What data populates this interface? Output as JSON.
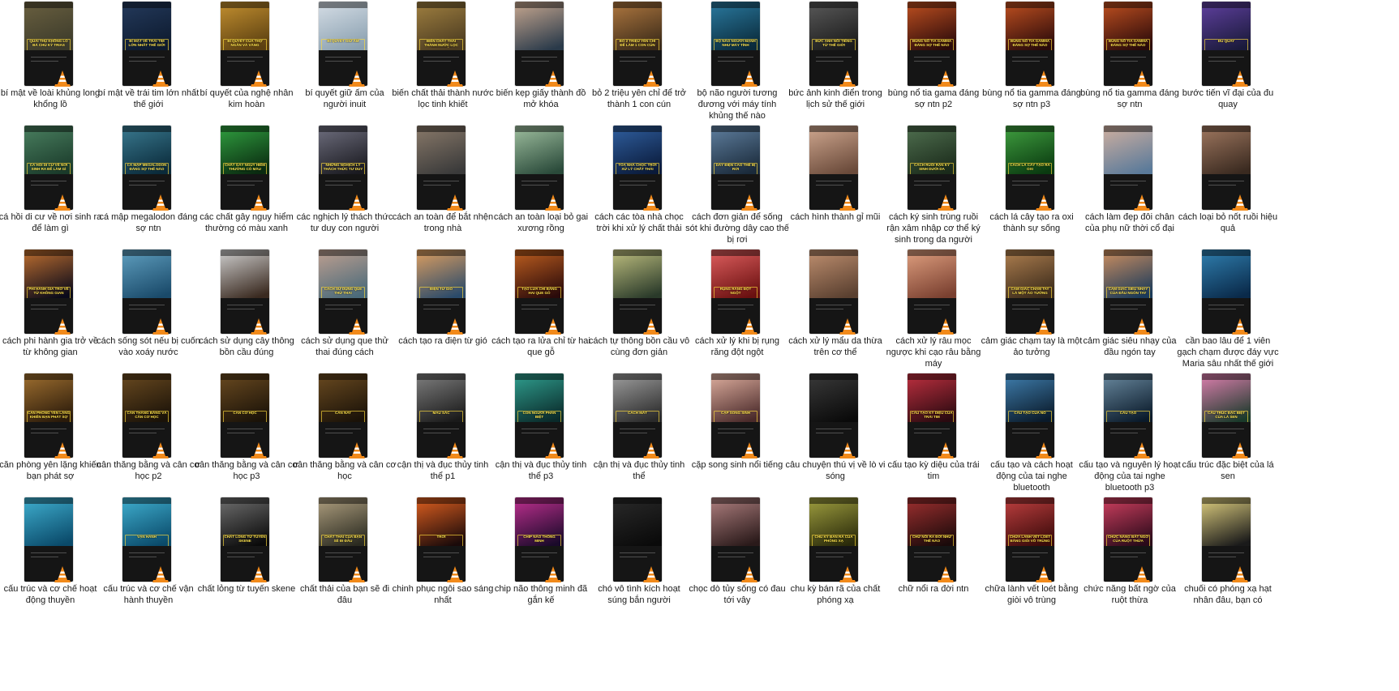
{
  "colors": {
    "background": "#ffffff",
    "label_text": "#1a1a1a",
    "caption_text": "#ffe44d",
    "vlc_orange": "#f28a1a",
    "vlc_white": "#ffffff"
  },
  "file_icon": "vlc-cone-icon",
  "files": [
    {
      "label": "bí mật về loài khủng long khổng lồ",
      "caption": "QUÁI THÚ KHỔNG LỒ BÁ CHỦ KỶ TRIAS",
      "thumb_colors": [
        "#3b3a2a",
        "#6a6040"
      ]
    },
    {
      "label": "bí mật về trái tim lớn nhất thế giới",
      "caption": "BÍ MẬT VỀ TRÁI TIM LỚN NHẤT THẾ GIỚI",
      "thumb_colors": [
        "#0d1a2e",
        "#243a5c"
      ]
    },
    {
      "label": "bí quyết của nghệ nhân kim hoàn",
      "caption": "BÍ QUYẾT CỦA THỢ NGÂN VÀ VÀNG",
      "thumb_colors": [
        "#5a3f10",
        "#c49030"
      ]
    },
    {
      "label": "bí quyết giữ ấm của người inuit",
      "caption": "BÍ QUYẾT GIỮ ẤM",
      "thumb_colors": [
        "#8aa0b0",
        "#d6dee6"
      ]
    },
    {
      "label": "biến chất thải thành nước lọc tinh khiết",
      "caption": "BIẾN CHẤT THẢI THÀNH NƯỚC LỌC TINH KHIẾT",
      "thumb_colors": [
        "#4a3a20",
        "#a08040"
      ]
    },
    {
      "label": "biến kẹp giấy thành đồ mở khóa",
      "caption": "",
      "thumb_colors": [
        "#2a3a4a",
        "#c8a890"
      ]
    },
    {
      "label": "bỏ 2 triệu yên chỉ để trở thành 1 con cún",
      "caption": "BỎ 2 TRIỆU YÊN CHỈ ĐỂ LÀM 1 CON CÚN",
      "thumb_colors": [
        "#3a2a18",
        "#b07840"
      ]
    },
    {
      "label": "bộ não người tương đương với máy tính khủng thế nào",
      "caption": "BỘ NÃO NGƯỜI MẠNH NHƯ MÁY TÍNH",
      "thumb_colors": [
        "#0a2a3a",
        "#2a7aa0"
      ]
    },
    {
      "label": "bức ảnh kinh điển trong lịch sử thế giới",
      "caption": "BỨC ẢNH NỔI TIẾNG TỪ THẾ GIỚI",
      "thumb_colors": [
        "#1a1a1a",
        "#5a5a5a"
      ]
    },
    {
      "label": "bùng nổ tia gama đáng sợ ntn p2",
      "caption": "BÙNG NỔ TIA GAMMA ĐÁNG SỢ THẾ NÀO",
      "thumb_colors": [
        "#2a0a0a",
        "#c05020"
      ]
    },
    {
      "label": "bùng nổ tia gamma đáng sợ ntn p3",
      "caption": "BÙNG NỔ TIA GAMMA ĐÁNG SỢ THẾ NÀO",
      "thumb_colors": [
        "#2a0a0a",
        "#c05020"
      ]
    },
    {
      "label": "bùng nổ tia gamma đáng sợ ntn",
      "caption": "BÙNG NỔ TIA GAMMA ĐÁNG SỢ THẾ NÀO",
      "thumb_colors": [
        "#2a0a0a",
        "#c05020"
      ]
    },
    {
      "label": "bước tiến vĩ đại của đu quay",
      "caption": "ĐU QUAY",
      "thumb_colors": [
        "#1a1a3a",
        "#6040a0"
      ]
    },
    {
      "label": "cá hồi di cư về nơi sinh ra để làm gì",
      "caption": "CÁ HỒI DI CƯ VỀ NƠI SINH RA ĐỂ LÀM GÌ",
      "thumb_colors": [
        "#1a3a2a",
        "#4a8060"
      ]
    },
    {
      "label": "cá mập megalodon đáng sợ ntn",
      "caption": "CÁ MẬP MEGALODON ĐÁNG SỢ THẾ NÀO",
      "thumb_colors": [
        "#0a2a3a",
        "#3a7a90"
      ]
    },
    {
      "label": "các chất gây nguy hiểm thường có màu xanh",
      "caption": "CHẤT GÂY NGUY HIỂM THƯỜNG CÓ MÀU XANH",
      "thumb_colors": [
        "#0a2a10",
        "#30a040"
      ]
    },
    {
      "label": "các nghịch lý thách thức tư duy con người",
      "caption": "NHỮNG NGHỊCH LÝ THÁCH THỨC TƯ DUY",
      "thumb_colors": [
        "#1a1a20",
        "#707080"
      ]
    },
    {
      "label": "cách an toàn để bắt nhện trong nhà",
      "caption": "",
      "thumb_colors": [
        "#3a3a3a",
        "#8a7a6a"
      ]
    },
    {
      "label": "cách an toàn loại bỏ gai xương rồng",
      "caption": "",
      "thumb_colors": [
        "#2a4a3a",
        "#a0c0a0"
      ]
    },
    {
      "label": "cách các tòa nhà chọc trời khi xử lý chất thải",
      "caption": "TÒA NHÀ CHỌC TRỜI XỬ LÝ CHẤT THẢI",
      "thumb_colors": [
        "#0a1a3a",
        "#3060a0"
      ]
    },
    {
      "label": "cách đơn giản để sống sót khi đường dây cao thế bị rơi",
      "caption": "DÂY ĐIỆN CAO THẾ BỊ RƠI",
      "thumb_colors": [
        "#1a2a3a",
        "#6080a0"
      ]
    },
    {
      "label": "cách hình thành gỉ mũi",
      "caption": "",
      "thumb_colors": [
        "#6a4a3a",
        "#d0a890"
      ]
    },
    {
      "label": "cách ký sinh trùng ruồi rận xâm nhập cơ thể ký sinh trong da người",
      "caption": "CÁCH RUỒI RẬN KÝ SINH DƯỚI DA",
      "thumb_colors": [
        "#1a2a1a",
        "#507050"
      ]
    },
    {
      "label": "cách lá cây tạo ra oxi thành sự sống",
      "caption": "CÁCH LÁ CÂY TẠO RA OXI",
      "thumb_colors": [
        "#0a3a10",
        "#40a040"
      ]
    },
    {
      "label": "cách làm đẹp đôi chân của phụ nữ thời cổ đại",
      "caption": "",
      "thumb_colors": [
        "#5a7a9a",
        "#d0b0a0"
      ]
    },
    {
      "label": "cách loại bỏ nốt ruồi hiệu quả",
      "caption": "",
      "thumb_colors": [
        "#3a2a20",
        "#a07860"
      ]
    },
    {
      "label": "cách phi hành gia trở về từ không gian",
      "caption": "PHI HÀNH GIA TRỞ VỀ TỪ KHÔNG GIAN",
      "thumb_colors": [
        "#0a0a1a",
        "#c07030"
      ]
    },
    {
      "label": "cách sống sót nếu bị cuốn vào xoáy nước",
      "caption": "",
      "thumb_colors": [
        "#1a4a6a",
        "#60a0c0"
      ]
    },
    {
      "label": "cách sử dụng cây thông bồn cầu đúng",
      "caption": "",
      "thumb_colors": [
        "#3a2a20",
        "#d0d0d0"
      ]
    },
    {
      "label": "cách sử dụng que thử thai đúng cách",
      "caption": "CÁCH SỬ DỤNG QUE THỬ THAI",
      "thumb_colors": [
        "#4a6a7a",
        "#c0a090"
      ]
    },
    {
      "label": "cách tạo ra điện từ gió",
      "caption": "ĐIỆN TỪ GIÓ",
      "thumb_colors": [
        "#2a4a6a",
        "#e0a060"
      ]
    },
    {
      "label": "cách tạo ra lửa chỉ từ hai que gỗ",
      "caption": "TẠO LỬA CHỈ BẰNG HAI QUE GỖ",
      "thumb_colors": [
        "#2a0a0a",
        "#c06020"
      ]
    },
    {
      "label": "cách tự thông bồn cầu vô cùng đơn giản",
      "caption": "",
      "thumb_colors": [
        "#2a3a2a",
        "#c0c080"
      ]
    },
    {
      "label": "cách xử lý khi bị rụng răng đột ngột",
      "caption": "RỤNG RĂNG ĐỘT NGỘT",
      "thumb_colors": [
        "#6a1010",
        "#e06060"
      ]
    },
    {
      "label": "cách xử lý mẩu da thừa trên cơ thể",
      "caption": "",
      "thumb_colors": [
        "#5a4030",
        "#c09070"
      ]
    },
    {
      "label": "cách xử lý râu mọc ngược khi cạo râu bằng máy",
      "caption": "",
      "thumb_colors": [
        "#7a4030",
        "#e0a080"
      ]
    },
    {
      "label": "cảm giác chạm tay là một ảo tưởng",
      "caption": "CẢM GIÁC CHẠM TAY LÀ MỘT ẢO TƯỞNG",
      "thumb_colors": [
        "#3a2a1a",
        "#b08050"
      ]
    },
    {
      "label": "cảm giác siêu nhạy của đầu ngón tay",
      "caption": "CẢM GIÁC SIÊU NHẠY CỦA ĐẦU NGÓN TAY",
      "thumb_colors": [
        "#1a3a5a",
        "#d09060"
      ]
    },
    {
      "label": "cần bao lâu để 1 viên gạch chạm được đáy vực Maria sâu nhất thế giới",
      "caption": "",
      "thumb_colors": [
        "#0a2a4a",
        "#3080b0"
      ]
    },
    {
      "label": "căn phòng yên lặng khiến bạn phát sợ",
      "caption": "CĂN PHÒNG YÊN LẶNG KHIẾN BẠN PHÁT SỢ",
      "thumb_colors": [
        "#2a1a0a",
        "#a07030"
      ]
    },
    {
      "label": "cân thăng bằng và cân cơ học p2",
      "caption": "CÂN THĂNG BẰNG VÀ CÂN CƠ HỌC",
      "thumb_colors": [
        "#1a1208",
        "#6a4a20"
      ]
    },
    {
      "label": "cân thăng bằng và cân cơ học p3",
      "caption": "CÂN CƠ HỌC",
      "thumb_colors": [
        "#1a1208",
        "#6a4a20"
      ]
    },
    {
      "label": "cân thăng bằng và cân cơ học",
      "caption": "CÂN NAY",
      "thumb_colors": [
        "#1a1208",
        "#6a4a20"
      ]
    },
    {
      "label": "cận thị và đục thủy tinh thể p1",
      "caption": "MÀU SẮC",
      "thumb_colors": [
        "#1a1a1a",
        "#808080"
      ]
    },
    {
      "label": "cận thị và đục thủy tinh thể p3",
      "caption": "CON NGƯƠI PHÂN BIỆT",
      "thumb_colors": [
        "#0a2a2a",
        "#30a090"
      ]
    },
    {
      "label": "cận thị và đục thủy tinh thể",
      "caption": "CÁCH MẮT",
      "thumb_colors": [
        "#2a2a2a",
        "#a0a0a0"
      ]
    },
    {
      "label": "cặp song sinh nổi tiếng",
      "caption": "CẶP SONG SINH",
      "thumb_colors": [
        "#4a2a2a",
        "#e0b0a0"
      ]
    },
    {
      "label": "câu chuyện thú vị về lò vi sóng",
      "caption": "",
      "thumb_colors": [
        "#0a0a0a",
        "#3a3a3a"
      ]
    },
    {
      "label": "cấu tạo kỳ diệu của trái tim",
      "caption": "CẤU TẠO KỲ DIỆU CỦA TRÁI TIM",
      "thumb_colors": [
        "#2a0a10",
        "#c03040"
      ]
    },
    {
      "label": "cấu tạo và cách hoạt động của tai nghe bluetooth",
      "caption": "CẤU TẠO CỦA NÓ",
      "thumb_colors": [
        "#0a1a2a",
        "#4080b0"
      ]
    },
    {
      "label": "cấu tạo và nguyên lý hoạt động của tai nghe bluetooth p3",
      "caption": "CẤU TẠO",
      "thumb_colors": [
        "#0a1a2a",
        "#6a8aa0"
      ]
    },
    {
      "label": "cấu trúc đặc biệt của lá sen",
      "caption": "CẤU TRÚC ĐẶC BIỆT CỦA LÁ SEN",
      "thumb_colors": [
        "#1a3a2a",
        "#e080b0"
      ]
    },
    {
      "label": "cấu trúc và cơ chế hoạt động thuyền",
      "caption": "",
      "thumb_colors": [
        "#0a4a6a",
        "#40b0d0"
      ]
    },
    {
      "label": "cấu trúc và cơ chế vận hành thuyền",
      "caption": "VẬN HÀNH",
      "thumb_colors": [
        "#0a4a6a",
        "#40b0d0"
      ]
    },
    {
      "label": "chất lỏng từ tuyến skene",
      "caption": "CHẤT LỎNG TỪ TUYẾN SKENE",
      "thumb_colors": [
        "#0a0a0a",
        "#707070"
      ]
    },
    {
      "label": "chất thải của bạn sẽ đi đâu",
      "caption": "CHẤT THẢI CỦA BẠN SẼ ĐI ĐÂU",
      "thumb_colors": [
        "#2a2a20",
        "#b0a080"
      ]
    },
    {
      "label": "chinh phục ngôi sao sáng nhất",
      "caption": "TRỜI",
      "thumb_colors": [
        "#1a0a0a",
        "#e06020"
      ]
    },
    {
      "label": "chip não thông minh đã gắn kế",
      "caption": "CHIP NÃO THÔNG MINH",
      "thumb_colors": [
        "#1a0a2a",
        "#c03090"
      ]
    },
    {
      "label": "chó vô tình kích hoạt súng bắn người",
      "caption": "",
      "thumb_colors": [
        "#0a0a0a",
        "#2a2a2a"
      ]
    },
    {
      "label": "chọc dò tủy sống có đau tới vây",
      "caption": "",
      "thumb_colors": [
        "#2a1a1a",
        "#b08080"
      ]
    },
    {
      "label": "chu kỳ bán rã của chất phóng xạ",
      "caption": "CHU KỲ BÁN RÃ CỦA PHÓNG XẠ",
      "thumb_colors": [
        "#2a2a0a",
        "#a0a040"
      ]
    },
    {
      "label": "chữ nổi ra đời ntn",
      "caption": "CHỮ NỔI RA ĐỜI NHƯ THẾ NÀO",
      "thumb_colors": [
        "#1a0a0a",
        "#a03030"
      ]
    },
    {
      "label": "chữa lành vết loét bằng giòi vô trùng",
      "caption": "CHỮA LÀNH VẾT LOÉT BẰNG GIÒI VÔ TRÙNG",
      "thumb_colors": [
        "#3a0a0a",
        "#c04040"
      ]
    },
    {
      "label": "chức năng bất ngờ của ruột thừa",
      "caption": "CHỨC NĂNG BẤT NGỜ CỦA RUỘT THỪA",
      "thumb_colors": [
        "#2a0a1a",
        "#d04060"
      ]
    },
    {
      "label": "chuối có phóng xạ hạt nhân đâu, bạn có",
      "caption": "",
      "thumb_colors": [
        "#1a1a1a",
        "#e0d080"
      ]
    }
  ]
}
